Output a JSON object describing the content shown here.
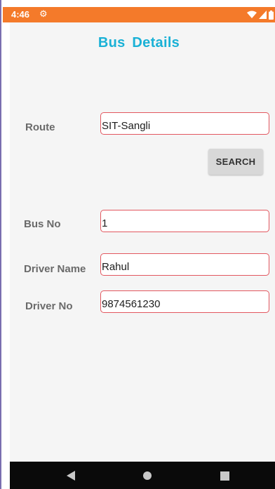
{
  "status_bar": {
    "time": "4:46",
    "icons": [
      "gear-icon",
      "wifi-icon",
      "signal-icon",
      "battery-icon"
    ],
    "color": "#f47a2a"
  },
  "page": {
    "title": "Bus  Details",
    "title_color": "#1ab1d6"
  },
  "form": {
    "route": {
      "label": "Route",
      "value": "SIT-Sangli"
    },
    "search_button": "SEARCH",
    "bus_no": {
      "label": "Bus No",
      "value": "1"
    },
    "driver_name": {
      "label": "Driver Name",
      "value": "Rahul"
    },
    "driver_no": {
      "label": "Driver No",
      "value": "9874561230"
    },
    "field_border_color": "#e2575f"
  },
  "nav_bar": {
    "buttons": [
      "back-icon",
      "home-icon",
      "recents-icon"
    ]
  }
}
